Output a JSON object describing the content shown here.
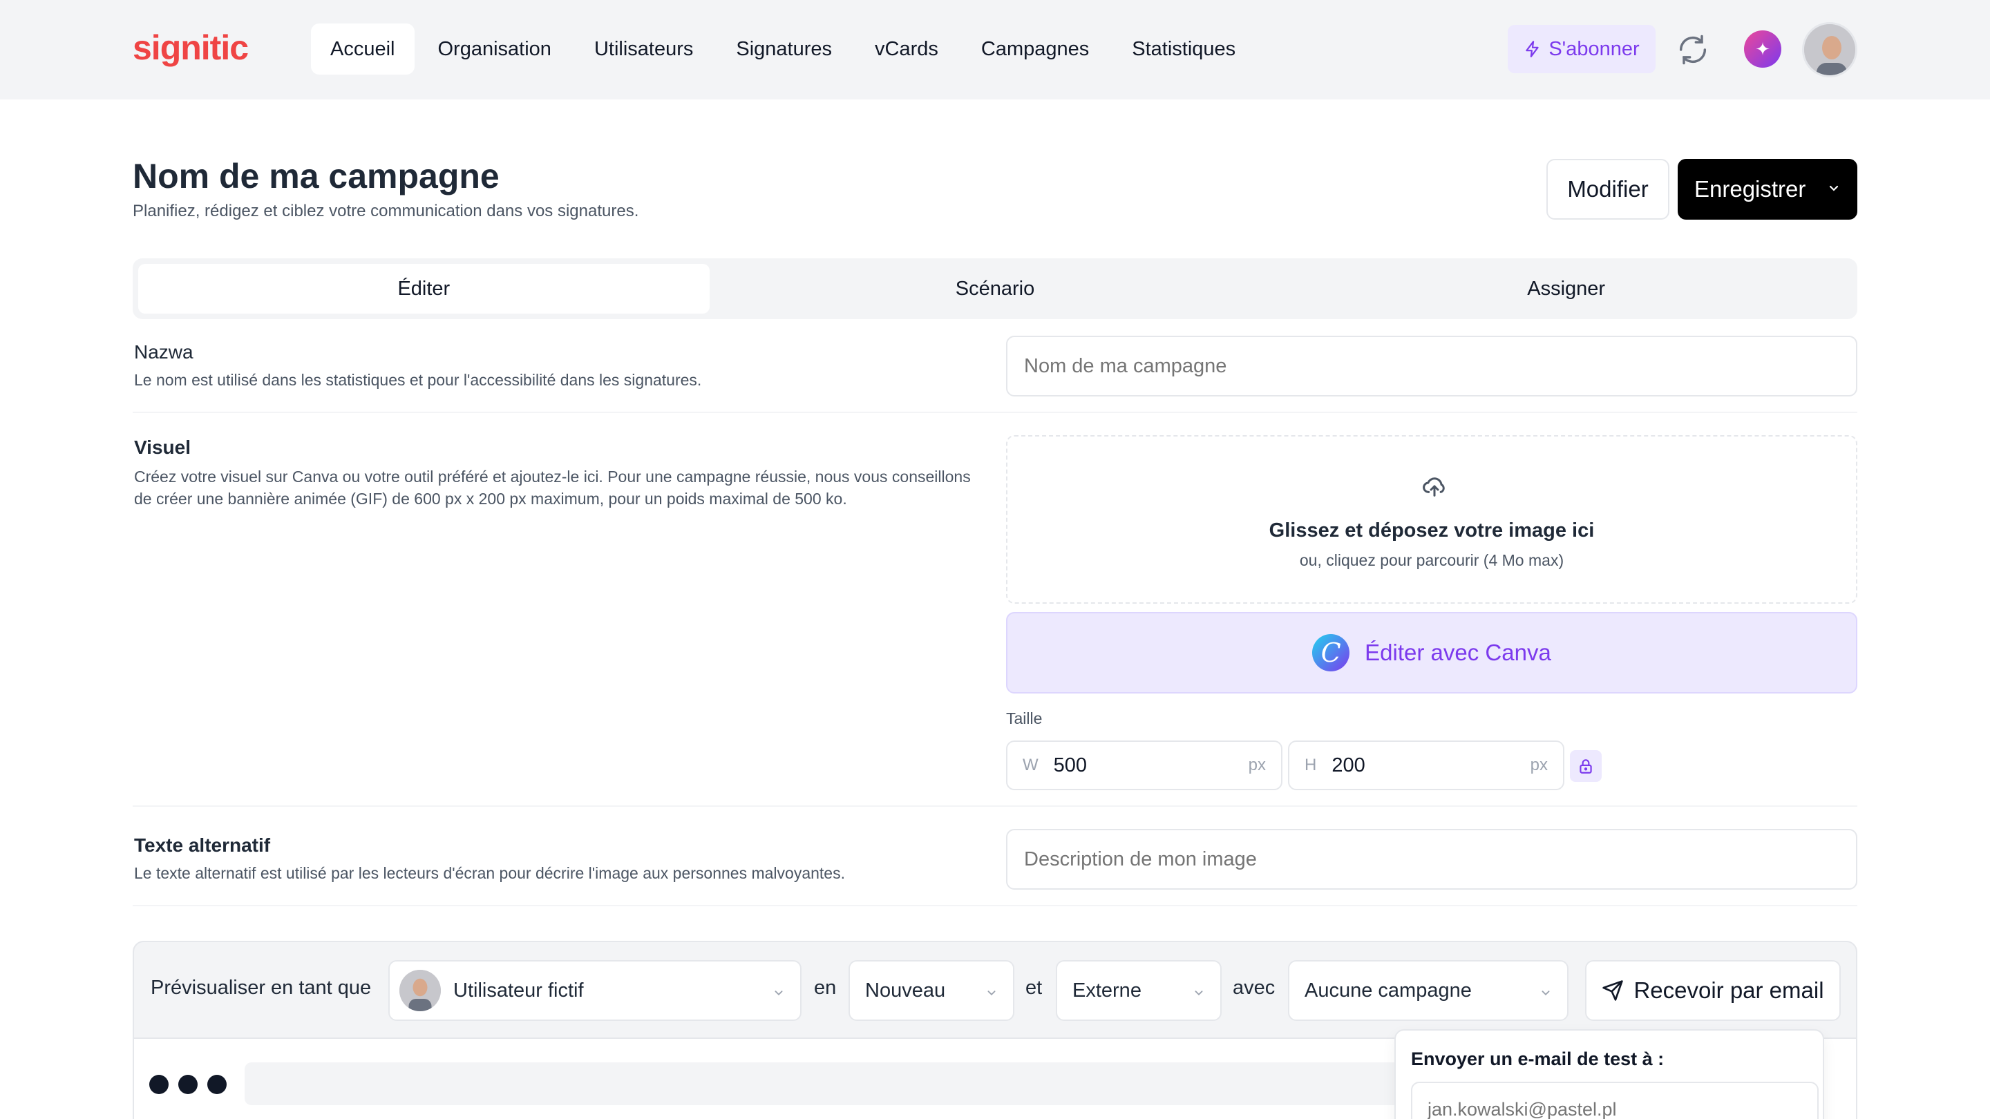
{
  "app": {
    "logo": "signitic"
  },
  "nav": {
    "items": [
      {
        "label": "Accueil",
        "active": true
      },
      {
        "label": "Organisation"
      },
      {
        "label": "Utilisateurs"
      },
      {
        "label": "Signatures"
      },
      {
        "label": "vCards"
      },
      {
        "label": "Campagnes"
      },
      {
        "label": "Statistiques"
      }
    ],
    "subscribe_label": "S'abonner"
  },
  "header": {
    "title": "Nom de ma campagne",
    "subtitle": "Planifiez, rédigez et ciblez votre communication dans vos signatures.",
    "modify_label": "Modifier",
    "save_label": "Enregistrer"
  },
  "tabs": [
    {
      "label": "Éditer",
      "active": true
    },
    {
      "label": "Scénario"
    },
    {
      "label": "Assigner"
    }
  ],
  "form": {
    "name": {
      "label": "Nazwa",
      "help": "Le nom est utilisé dans les statistiques et pour l'accessibilité dans les signatures.",
      "placeholder": "Nom de ma campagne",
      "value": ""
    },
    "visual": {
      "label": "Visuel",
      "help": "Créez votre visuel sur Canva ou votre outil préféré et ajoutez-le ici. Pour une campagne réussie, nous vous conseillons de créer une bannière animée (GIF) de 600 px x 200 px maximum, pour un poids maximal de 500 ko.",
      "dropzone_title": "Glissez et déposez votre image ici",
      "dropzone_sub": "ou, cliquez pour parcourir (4 Mo max)",
      "canva_label": "Éditer avec Canva",
      "size_label": "Taille",
      "width_prefix": "W",
      "width": "500",
      "height_prefix": "H",
      "height": "200",
      "unit": "px"
    },
    "alt": {
      "label": "Texte alternatif",
      "help": "Le texte alternatif est utilisé par les lecteurs d'écran pour décrire l'image aux personnes malvoyantes.",
      "placeholder": "Description de mon image",
      "value": ""
    }
  },
  "preview": {
    "prefix": "Prévisualiser en tant que",
    "user": "Utilisateur fictif",
    "word_en": "en",
    "status": "Nouveau",
    "word_et": "et",
    "audience": "Externe",
    "word_avec": "avec",
    "campaign": "Aucune campagne",
    "email_button": "Recevoir par email"
  },
  "test_email": {
    "title": "Envoyer un e-mail de test à :",
    "placeholder": "jan.kowalski@pastel.pl"
  },
  "colors": {
    "brand": "#ef4444",
    "accent": "#7c3aed",
    "accent_bg": "#ede9fe"
  }
}
